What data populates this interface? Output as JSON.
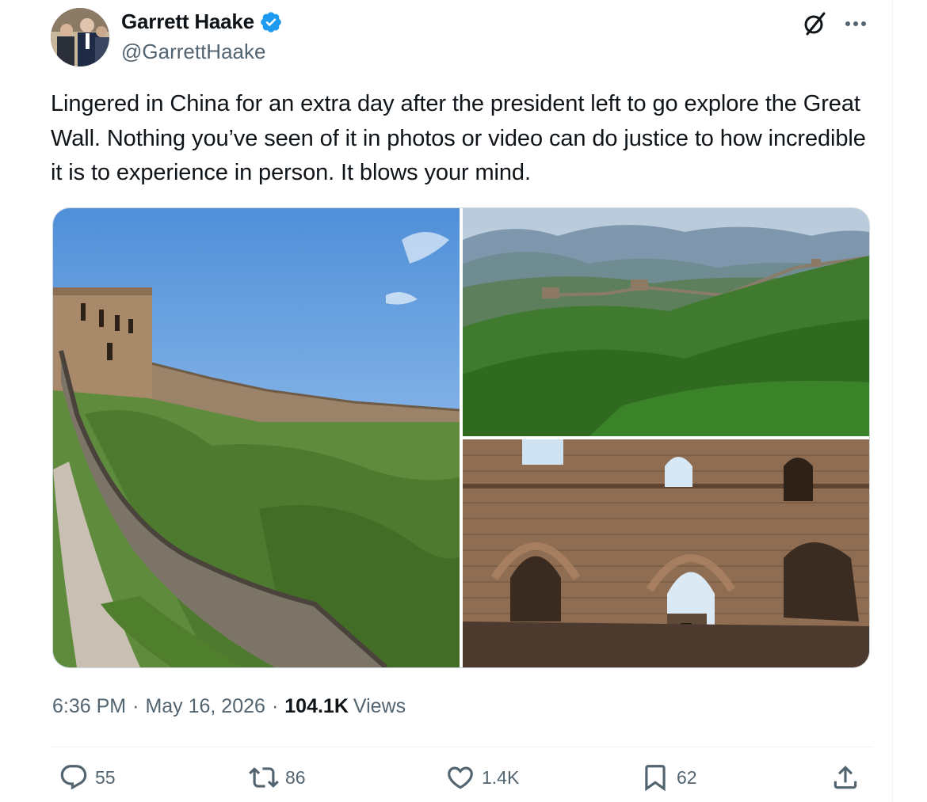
{
  "author": {
    "display_name": "Garrett Haake",
    "handle": "@GarrettHaake",
    "verified": true,
    "verified_color": "#1d9bf0"
  },
  "header_icons": {
    "grok": "grok-icon",
    "more": "more-icon"
  },
  "tweet": {
    "text": "Lingered in China for an extra day after the president left to go explore the Great Wall. Nothing you’ve seen of it in photos or video can do justice to how incredible it is to experience in person. It blows your mind."
  },
  "media": [
    {
      "name": "great-wall-ramparts-photo"
    },
    {
      "name": "great-wall-mountains-photo"
    },
    {
      "name": "great-wall-brick-arches-photo"
    }
  ],
  "meta": {
    "time": "6:36 PM",
    "separator": "·",
    "date": "May 16, 2026",
    "views_count": "104.1K",
    "views_label": "Views"
  },
  "actions": {
    "replies": "55",
    "reposts": "86",
    "likes": "1.4K",
    "bookmarks": "62"
  },
  "colors": {
    "text_primary": "#0f1419",
    "text_secondary": "#536471",
    "border": "#eff3f4"
  }
}
